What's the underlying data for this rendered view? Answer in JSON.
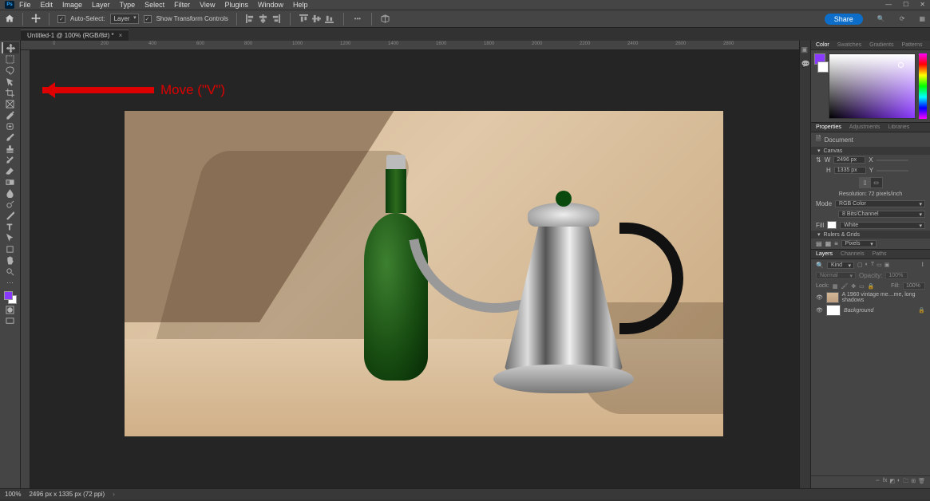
{
  "menu": [
    "File",
    "Edit",
    "Image",
    "Layer",
    "Type",
    "Select",
    "Filter",
    "View",
    "Plugins",
    "Window",
    "Help"
  ],
  "window_buttons": [
    "—",
    "☐",
    "✕"
  ],
  "options_bar": {
    "auto_select_label": "Auto-Select:",
    "auto_select_target": "Layer",
    "show_tc": "Show Transform Controls"
  },
  "document_tab": "Untitled-1 @ 100% (RGB/8#) *",
  "ruler_marks": [
    "0",
    "200",
    "400",
    "600",
    "800",
    "1000",
    "1200",
    "1400",
    "1600",
    "1800",
    "2000",
    "2200",
    "2400",
    "2600",
    "2800"
  ],
  "annotation": "Move (\"V\")",
  "color_panel_tabs": [
    "Color",
    "Swatches",
    "Gradients",
    "Patterns"
  ],
  "prop_tabs": [
    "Properties",
    "Adjustments",
    "Libraries"
  ],
  "properties": {
    "doc_label": "Document",
    "canvas_header": "Canvas",
    "w_label": "W",
    "w_val": "2496 px",
    "x_label": "X",
    "h_label": "H",
    "h_val": "1335 px",
    "y_label": "Y",
    "resolution": "Resolution: 72 pixels/inch",
    "mode_label": "Mode",
    "mode_val": "RGB Color",
    "depth_val": "8 Bits/Channel",
    "fill_label": "Fill",
    "fill_val": "White",
    "rulers_header": "Rulers & Grids",
    "ruler_units": "Pixels"
  },
  "layers_tabs": [
    "Layers",
    "Channels",
    "Paths"
  ],
  "layers_panel": {
    "kind": "Kind",
    "blend": "Normal",
    "opacity_label": "Opacity:",
    "opacity_val": "100%",
    "lock_label": "Lock:",
    "fill_label": "Fill:",
    "fill_val": "100%",
    "layer1": "A 1960 vintage me…me, long shadows",
    "layer2": "Background"
  },
  "status_bar": {
    "zoom": "100%",
    "doc_info": "2496 px x 1335 px (72 ppi)"
  },
  "share_label": "Share",
  "colors": {
    "accent": "#8a39ff"
  }
}
